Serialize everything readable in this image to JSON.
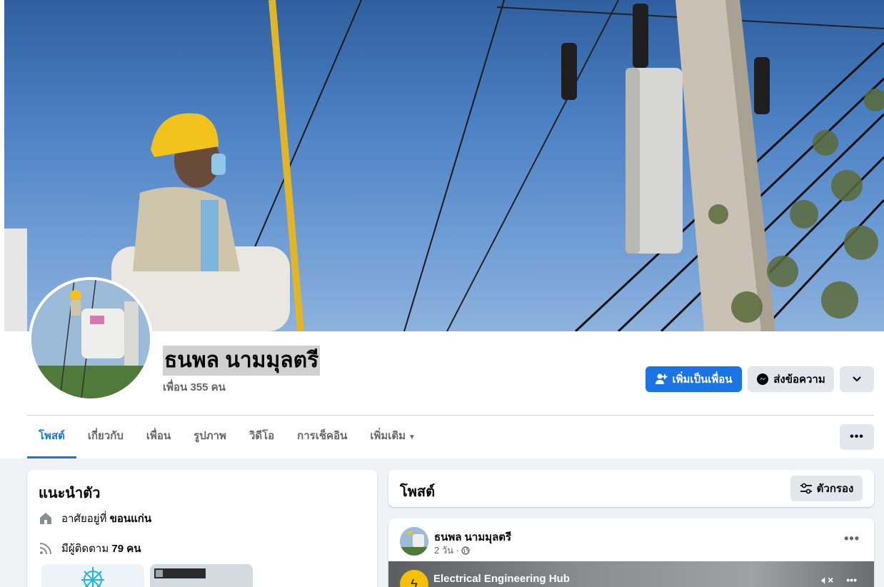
{
  "profile": {
    "name": "ธนพล นามมุลตรี",
    "friends_count": "เพื่อน 355 คน"
  },
  "actions": {
    "add_friend": "เพิ่มเป็นเพื่อน",
    "message": "ส่งข้อความ",
    "more_icon": "chevron-down-icon"
  },
  "tabs": [
    {
      "label": "โพสต์",
      "active": true
    },
    {
      "label": "เกี่ยวกับ"
    },
    {
      "label": "เพื่อน"
    },
    {
      "label": "รูปภาพ"
    },
    {
      "label": "วิดีโอ"
    },
    {
      "label": "การเช็คอิน"
    },
    {
      "label": "เพิ่มเติม"
    }
  ],
  "tabs_more_icon": "ellipsis-icon",
  "intro": {
    "title": "แนะนำตัว",
    "lives_prefix": "อาศัยอยู่ที่",
    "lives_place": "ขอนแก่น",
    "followers_prefix": "มีผู้ติดตาม",
    "followers_value": "79 คน"
  },
  "posts_header": {
    "title": "โพสต์",
    "filter_label": "ตัวกรอง"
  },
  "post": {
    "author": "ธนพล นามมุลตรี",
    "time": "2 วัน ·",
    "video_title": "Electrical Engineering Hub"
  },
  "colors": {
    "accent": "#1b74e4",
    "secondary_button": "#e4e6eb",
    "page_bg": "#f0f2f5"
  }
}
